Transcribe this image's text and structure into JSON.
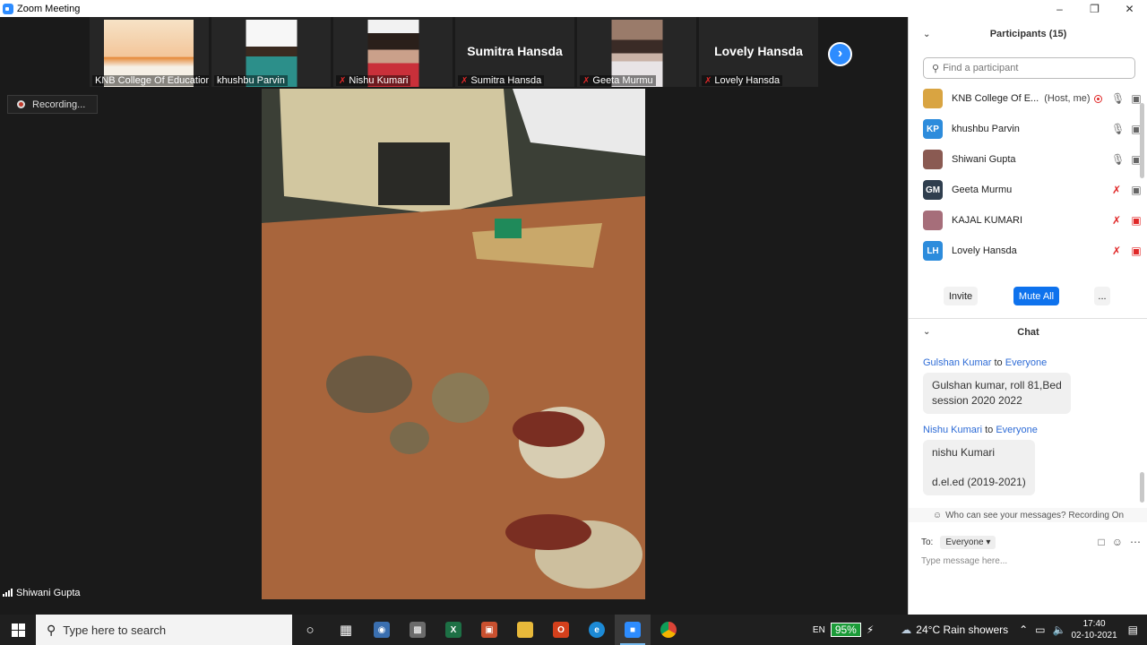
{
  "window": {
    "title": "Zoom Meeting"
  },
  "thumbnails": [
    {
      "name": "KNB College Of Education",
      "display": "photo",
      "muted": false
    },
    {
      "name": "khushbu Parvin",
      "display": "photo",
      "muted": false
    },
    {
      "name": "Nishu Kumari",
      "display": "photo",
      "muted": true
    },
    {
      "name": "Sumitra Hansda",
      "display": "name",
      "muted": true
    },
    {
      "name": "Geeta Murmu",
      "display": "photo",
      "muted": true
    },
    {
      "name": "Lovely Hansda",
      "display": "name",
      "muted": true
    }
  ],
  "recording_label": "Recording...",
  "active_speaker": "Shiwani Gupta",
  "participants_panel": {
    "title": "Participants (15)",
    "search_placeholder": "Find a participant",
    "participants": [
      {
        "name": "KNB College Of E...",
        "extra": "(Host, me)",
        "initials": "",
        "color": "#d9a441",
        "mic": "on",
        "video": "on"
      },
      {
        "name": "khushbu Parvin",
        "extra": "",
        "initials": "KP",
        "color": "#2d8cdc",
        "mic": "on",
        "video": "on"
      },
      {
        "name": "Shiwani Gupta",
        "extra": "",
        "initials": "",
        "color": "#8a5a52",
        "mic": "on",
        "video": "on"
      },
      {
        "name": "Geeta Murmu",
        "extra": "",
        "initials": "GM",
        "color": "#2f3e4e",
        "mic": "off",
        "video": "on"
      },
      {
        "name": "KAJAL KUMARI",
        "extra": "",
        "initials": "",
        "color": "#a66e7a",
        "mic": "off",
        "video": "off"
      },
      {
        "name": "Lovely Hansda",
        "extra": "",
        "initials": "LH",
        "color": "#2d8cdc",
        "mic": "off",
        "video": "off"
      }
    ],
    "buttons": {
      "invite": "Invite",
      "mute_all": "Mute All",
      "more": "..."
    }
  },
  "chat": {
    "title": "Chat",
    "messages": [
      {
        "sender": "Gulshan Kumar",
        "to_word": "to",
        "recipient": "Everyone",
        "lines": [
          "Gulshan kumar, roll 81,Bed",
          "session 2020 2022"
        ]
      },
      {
        "sender": "Nishu Kumari",
        "to_word": "to",
        "recipient": "Everyone",
        "lines": [
          "nishu Kumari",
          "",
          "d.el.ed  (2019-2021)"
        ]
      }
    ],
    "who_can_see": "Who can see your messages? Recording On",
    "to_label": "To:",
    "to_value": "Everyone",
    "input_placeholder": "Type message here..."
  },
  "taskbar": {
    "search_placeholder": "Type here to search",
    "language": "EN",
    "battery": "95%",
    "weather": "24°C  Rain showers",
    "time": "17:40",
    "date": "02-10-2021"
  },
  "colors": {
    "accent": "#0e72ed",
    "mic_off": "#e02828",
    "stage": "#1a1a1a"
  }
}
